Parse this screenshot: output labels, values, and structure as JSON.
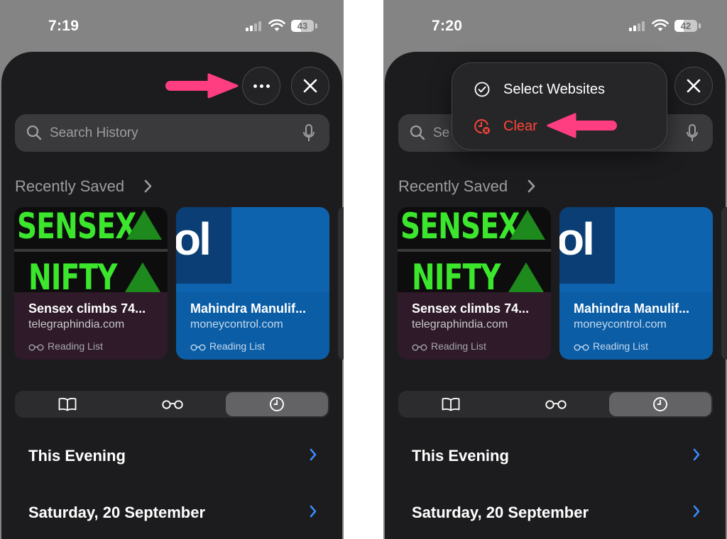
{
  "colors": {
    "accent_arrow": "#ff3d81",
    "sheet_bg": "#1c1c1e",
    "chevron_blue": "#3b8cff",
    "destructive": "#ff453a"
  },
  "left": {
    "status": {
      "time": "7:19",
      "battery": "43",
      "battery_level": 0.43
    },
    "search": {
      "placeholder": "Search History"
    },
    "recently_saved": {
      "title": "Recently Saved",
      "cards": [
        {
          "thumb_text_1": "SENSEX",
          "thumb_text_2": "NIFTY",
          "title": "Sensex climbs 74...",
          "domain": "telegraphindia.com",
          "meta": "Reading List"
        },
        {
          "thumb_text": "ol",
          "title": "Mahindra Manulif...",
          "domain": "moneycontrol.com",
          "meta": "Reading List"
        }
      ]
    },
    "history": [
      {
        "label": "This Evening"
      },
      {
        "label": "Saturday, 20 September"
      }
    ]
  },
  "right": {
    "status": {
      "time": "7:20",
      "battery": "42",
      "battery_level": 0.42
    },
    "search": {
      "placeholder": "Se"
    },
    "menu": {
      "items": [
        {
          "label": "Select Websites",
          "icon": "checkmark-circle-icon"
        },
        {
          "label": "Clear",
          "icon": "clock-clear-icon"
        }
      ]
    },
    "recently_saved": {
      "title": "Recently Saved",
      "cards": [
        {
          "thumb_text_1": "SENSEX",
          "thumb_text_2": "NIFTY",
          "title": "Sensex climbs 74...",
          "domain": "telegraphindia.com",
          "meta": "Reading List"
        },
        {
          "thumb_text": "ol",
          "title": "Mahindra Manulif...",
          "domain": "moneycontrol.com",
          "meta": "Reading List"
        }
      ]
    },
    "history": [
      {
        "label": "This Evening"
      },
      {
        "label": "Saturday, 20 September"
      }
    ]
  }
}
